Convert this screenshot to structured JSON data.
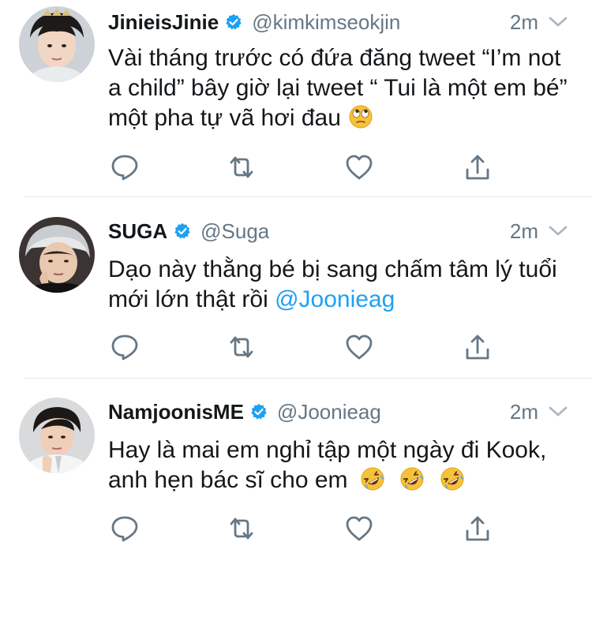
{
  "tweets": [
    {
      "display_name": "JinieisJinie",
      "handle": "@kimkimseokjin",
      "time": "2m",
      "text": "Vài tháng trước có đứa đăng tweet “I’m not a child” bây giờ lại tweet “ Tui là một em bé” một pha tự vã hơi đau",
      "emoji": [
        "face-with-rolling-eyes"
      ]
    },
    {
      "display_name": "SUGA",
      "handle": "@Suga",
      "time": "2m",
      "text": "Dạo này thằng bé bị sang chấm tâm lý tuổi mới lớn thật rồi",
      "mention": "@Joonieag"
    },
    {
      "display_name": "NamjoonisME",
      "handle": "@Joonieag",
      "time": "2m",
      "text": "Hay là mai em nghỉ tập một ngày đi Kook, anh hẹn bác sĩ cho em",
      "emoji": [
        "rolling-on-floor-laughing",
        "rolling-on-floor-laughing",
        "rolling-on-floor-laughing"
      ]
    }
  ],
  "colors": {
    "text": "#14171a",
    "secondary": "#657786",
    "link": "#1da1f2",
    "verified": "#1da1f2",
    "divider": "#e1e8ed"
  },
  "icons": [
    "reply-icon",
    "retweet-icon",
    "like-icon",
    "share-icon",
    "verified-badge-icon",
    "chevron-down-icon"
  ]
}
